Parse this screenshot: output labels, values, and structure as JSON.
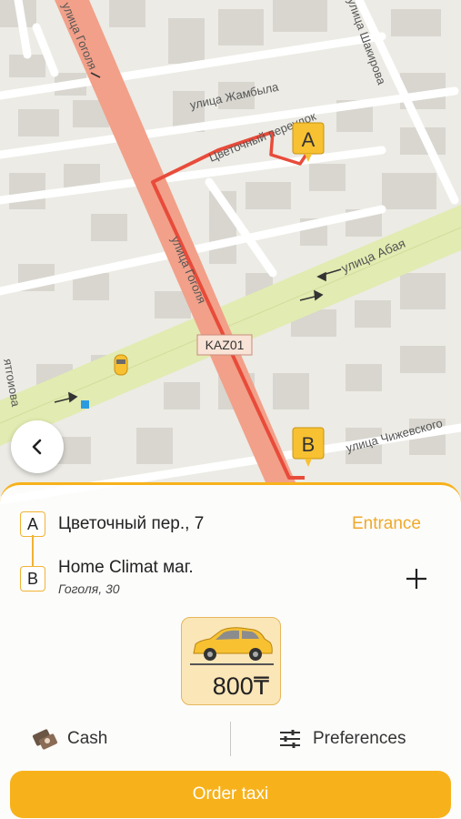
{
  "map": {
    "streets": {
      "gogolya_vertical": "улица Гоголя",
      "gogolya_diagonal": "улица Гоголя",
      "zhambyla": "улица Жамбыла",
      "shakirova": "улица Шакирова",
      "tsvetochny": "Цветочный переулок",
      "abaya": "улица Абая",
      "chizhevskogo": "улица Чижевского",
      "left_cut": "ятгоиова"
    },
    "road_badge": "KAZ01",
    "marker_a": "A",
    "marker_b": "B",
    "colors": {
      "route": "#e84b3a",
      "road": "#f2a58c",
      "highway": "#e4ecb0",
      "marker": "#f7c132"
    }
  },
  "route": {
    "from": {
      "marker": "A",
      "address": "Цветочный пер., 7",
      "action": "Entrance"
    },
    "to": {
      "marker": "B",
      "address": "Home Climat маг.",
      "subtitle": "Гоголя, 30"
    },
    "add_stop_icon": "plus-icon"
  },
  "tariff": {
    "icon": "car-icon",
    "price": "800₸"
  },
  "payment": {
    "icon": "cash-icon",
    "label": "Cash"
  },
  "preferences": {
    "icon": "sliders-icon",
    "label": "Preferences"
  },
  "order_button": "Order taxi",
  "back_icon": "chevron-left-icon",
  "accent_color": "#f7b21b"
}
